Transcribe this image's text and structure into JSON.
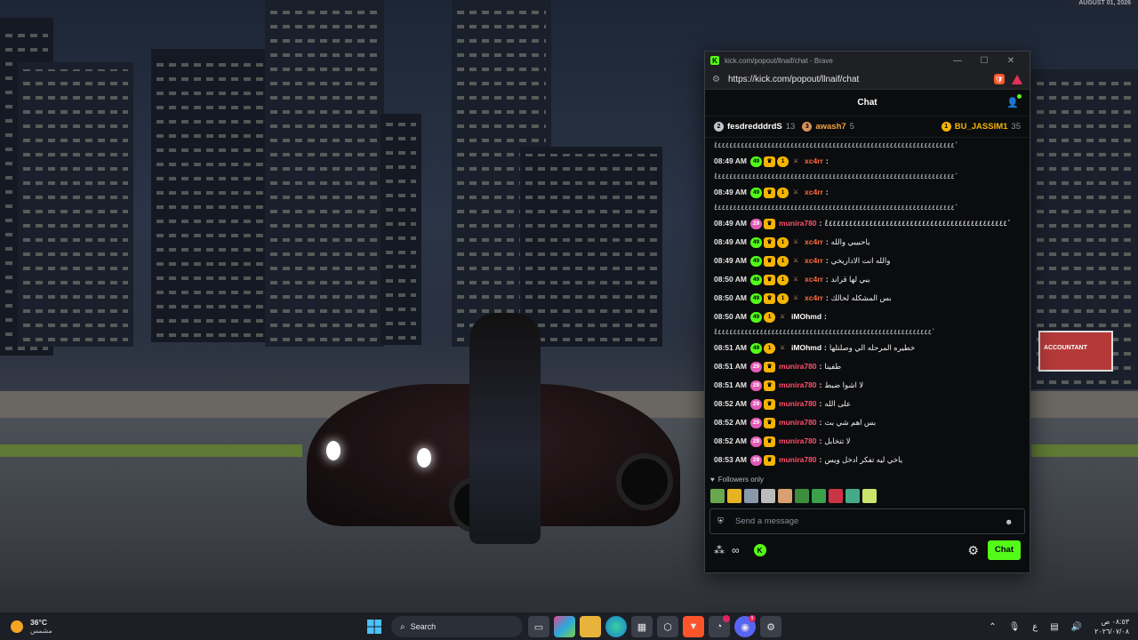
{
  "desktop": {
    "date_chip": "AUGUST 01, 2026",
    "billboard_text": "ACCOUNTANT"
  },
  "browser": {
    "title": "kick.com/popout/llnaif/chat - Brave",
    "url": "https://kick.com/popout/llnaif/chat",
    "controls": {
      "minimize": "—",
      "maximize": "☐",
      "close": "✕"
    }
  },
  "chat": {
    "header": "Chat",
    "leaderboard": [
      {
        "rank": "2",
        "rank_color": "#c0c4cc",
        "name": "fesdredddrdS",
        "name_color": "#ffffff",
        "count": "13"
      },
      {
        "rank": "3",
        "rank_color": "#d8925a",
        "name": "awash7",
        "name_color": "#f4a340",
        "count": "5"
      },
      {
        "rank": "1",
        "rank_color": "#f4b400",
        "name": "BU_JASSIM1",
        "name_color": "#f4b400",
        "count": "35"
      }
    ],
    "messages": [
      {
        "kind": "spam",
        "text": "ٔ٤٤٤٤٤٤٤٤٤٤٤٤٤٤٤٤٤٤٤٤٤٤٤٤٤٤٤٤٤٤٤٤٤٤٤٤٤٤٤٤٤٤٤٤٤٤٤٤٤٤٤٤٤٤٤٤٤٤٤٤٤٤٤ٔ"
      },
      {
        "kind": "msg",
        "time": "08:49 AM",
        "sub": "49",
        "badges": [
          "crown",
          "gift",
          "sword"
        ],
        "user": "xc4rr",
        "color": "#ff6a3d",
        "text": ""
      },
      {
        "kind": "spam",
        "text": "ٔ٤٤٤٤٤٤٤٤٤٤٤٤٤٤٤٤٤٤٤٤٤٤٤٤٤٤٤٤٤٤٤٤٤٤٤٤٤٤٤٤٤٤٤٤٤٤٤٤٤٤٤٤٤٤٤٤٤٤٤٤٤٤٤ٔ"
      },
      {
        "kind": "msg",
        "time": "08:49 AM",
        "sub": "49",
        "badges": [
          "crown",
          "gift",
          "sword"
        ],
        "user": "xc4rr",
        "color": "#ff6a3d",
        "text": ""
      },
      {
        "kind": "spam",
        "text": "ٔ٤٤٤٤٤٤٤٤٤٤٤٤٤٤٤٤٤٤٤٤٤٤٤٤٤٤٤٤٤٤٤٤٤٤٤٤٤٤٤٤٤٤٤٤٤٤٤٤٤٤٤٤٤٤٤٤٤٤٤٤٤٤٤ٔ"
      },
      {
        "kind": "msg",
        "time": "08:49 AM",
        "sub": "29",
        "pink": true,
        "badges": [
          "crown"
        ],
        "user": "munira780",
        "color": "#ff4f6b",
        "text": "ٔ٤٤٤٤٤٤٤٤٤٤٤٤٤٤٤٤٤٤٤٤٤٤٤٤٤٤٤٤٤٤٤٤٤٤٤٤٤٤٤٤٤٤٤٤٤ٔ"
      },
      {
        "kind": "msg",
        "time": "08:49 AM",
        "sub": "49",
        "badges": [
          "crown",
          "gift",
          "sword"
        ],
        "user": "xc4rr",
        "color": "#ff6a3d",
        "text": "ياحبيبي والله"
      },
      {
        "kind": "msg",
        "time": "08:49 AM",
        "sub": "49",
        "badges": [
          "crown",
          "gift",
          "sword"
        ],
        "user": "xc4rr",
        "color": "#ff6a3d",
        "text": "والله انت الاداريخي"
      },
      {
        "kind": "msg",
        "time": "08:50 AM",
        "sub": "49",
        "badges": [
          "crown",
          "gift",
          "sword"
        ],
        "user": "xc4rr",
        "color": "#ff6a3d",
        "text": "يبي لها قراند"
      },
      {
        "kind": "msg",
        "time": "08:50 AM",
        "sub": "49",
        "badges": [
          "crown",
          "gift",
          "sword"
        ],
        "user": "xc4rr",
        "color": "#ff6a3d",
        "text": "بس المشكله لحالك"
      },
      {
        "kind": "msg",
        "time": "08:50 AM",
        "sub": "49",
        "badges": [
          "gift",
          "sword"
        ],
        "user": "iMOhmd",
        "color": "#ffffff",
        "text": ""
      },
      {
        "kind": "spam",
        "text": "ٔ٤٤٤٤٤٤٤٤٤٤٤٤٤٤٤٤٤٤٤٤٤٤٤٤٤٤٤٤٤٤٤٤٤٤٤٤٤٤٤٤٤٤٤٤٤٤٤٤٤٤٤٤٤٤٤٤٤ٔ"
      },
      {
        "kind": "msg",
        "time": "08:51 AM",
        "sub": "49",
        "badges": [
          "gift",
          "sword"
        ],
        "user": "iMOhmd",
        "color": "#ffffff",
        "text": "خطيره المرحله الي وصلتلها"
      },
      {
        "kind": "msg",
        "time": "08:51 AM",
        "sub": "29",
        "pink": true,
        "badges": [
          "crown"
        ],
        "user": "munira780",
        "color": "#ff4f6b",
        "text": "طفينا"
      },
      {
        "kind": "msg",
        "time": "08:51 AM",
        "sub": "29",
        "pink": true,
        "badges": [
          "crown"
        ],
        "user": "munira780",
        "color": "#ff4f6b",
        "text": "لا اشوا ضبط"
      },
      {
        "kind": "msg",
        "time": "08:52 AM",
        "sub": "29",
        "pink": true,
        "badges": [
          "crown"
        ],
        "user": "munira780",
        "color": "#ff4f6b",
        "text": "على الله"
      },
      {
        "kind": "msg",
        "time": "08:52 AM",
        "sub": "29",
        "pink": true,
        "badges": [
          "crown"
        ],
        "user": "munira780",
        "color": "#ff4f6b",
        "text": "بس اهم شي بث"
      },
      {
        "kind": "msg",
        "time": "08:52 AM",
        "sub": "29",
        "pink": true,
        "badges": [
          "crown"
        ],
        "user": "munira780",
        "color": "#ff4f6b",
        "text": "لا تتخابل"
      },
      {
        "kind": "msg",
        "time": "08:53 AM",
        "sub": "29",
        "pink": true,
        "badges": [
          "crown"
        ],
        "user": "munira780",
        "color": "#ff4f6b",
        "text": "ياخي ليه تفكر ادخل ويس"
      }
    ],
    "followers_only": "Followers only",
    "emotes": [
      "#6aa84f",
      "#e6b422",
      "#8899aa",
      "#bbbbbb",
      "#d8a070",
      "#3c8d3c",
      "#3aa04a",
      "#cc3344",
      "#44aa88",
      "#c8e66a"
    ],
    "input_placeholder": "Send a message",
    "send_label": "Chat"
  },
  "taskbar": {
    "temp": "36°C",
    "condition": "مشمس",
    "search_label": "Search",
    "language": "ع",
    "time": "٠٨:٥٣ ص",
    "date": "٢٠٢٦/٠٧/٠٨"
  }
}
